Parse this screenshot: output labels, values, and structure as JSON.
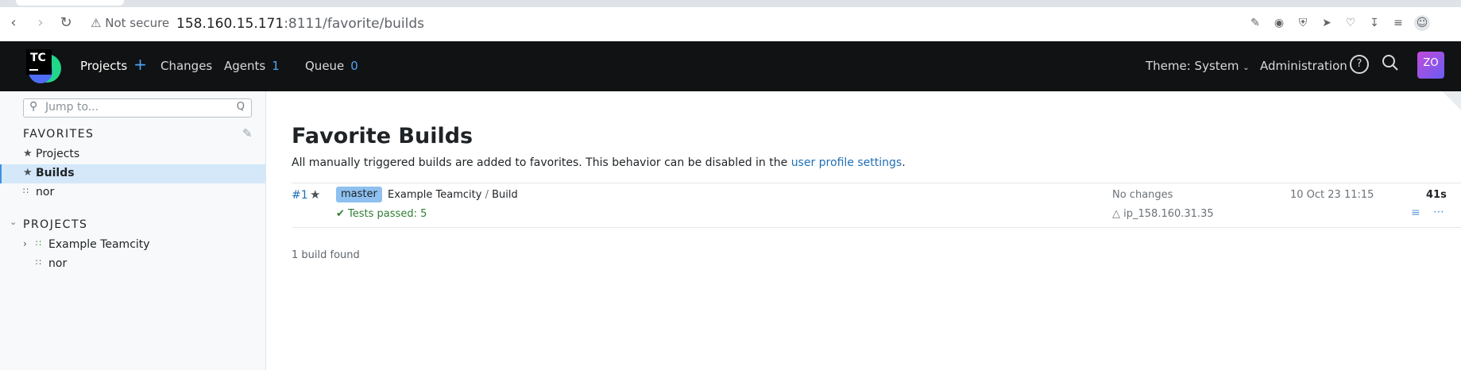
{
  "browser": {
    "address_warning": "Not secure",
    "host": "158.160.15.171",
    "path": ":8111/favorite/builds"
  },
  "header": {
    "projects": "Projects",
    "changes": "Changes",
    "agents": "Agents",
    "agents_count": "1",
    "queue": "Queue",
    "queue_count": "0",
    "theme": "Theme: System",
    "administration": "Administration",
    "avatar": "ZO",
    "logo": "TC"
  },
  "sidebar": {
    "jump_placeholder": "Jump to...",
    "jump_shortcut": "Q",
    "favorites_heading": "FAVORITES",
    "favorites": [
      {
        "label": "Projects"
      },
      {
        "label": "Builds"
      },
      {
        "label": "nor"
      }
    ],
    "projects_heading": "PROJECTS",
    "projects": [
      {
        "label": "Example Teamcity"
      },
      {
        "label": "nor"
      }
    ]
  },
  "main": {
    "title": "Favorite Builds",
    "description": "All manually triggered builds are added to favorites. This behavior can be disabled in the",
    "description_link": "user profile settings",
    "description_end": ".",
    "build": {
      "number": "#1",
      "branch": "master",
      "project": "Example Teamcity",
      "separator": "/",
      "config": "Build",
      "tests": "Tests passed: 5",
      "changes": "No changes",
      "agent": "ip_158.160.31.35",
      "date": "10 Oct 23 11:15",
      "duration": "41s"
    },
    "found_text": "1 build found"
  }
}
